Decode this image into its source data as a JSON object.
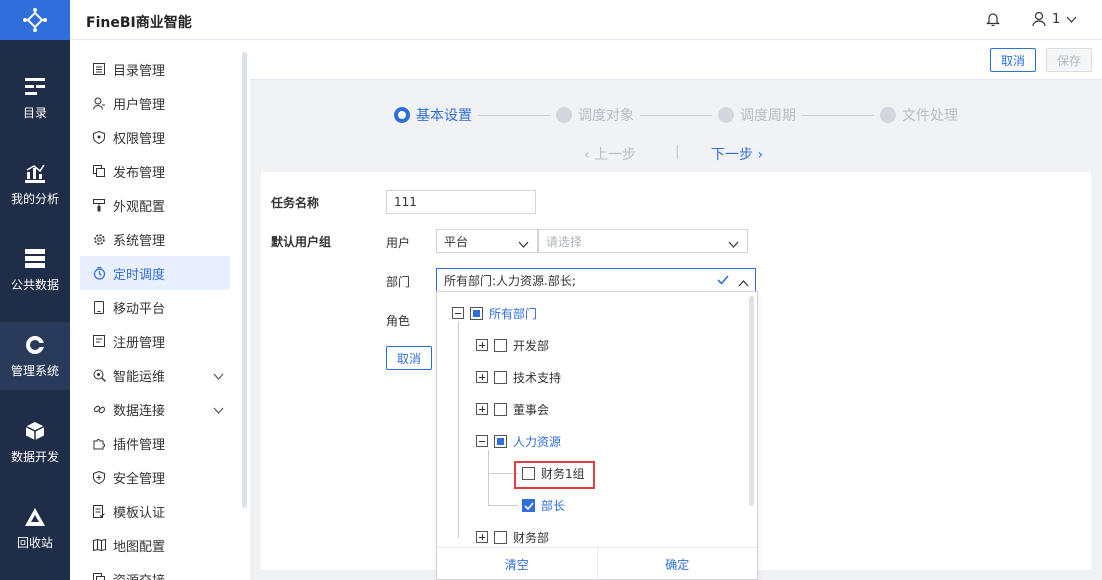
{
  "app": {
    "title": "FineBI商业智能",
    "user": "1"
  },
  "leftnav": [
    {
      "label": "目录",
      "icon": "catalog-icon"
    },
    {
      "label": "我的分析",
      "icon": "analysis-icon"
    },
    {
      "label": "公共数据",
      "icon": "database-icon"
    },
    {
      "label": "管理系统",
      "icon": "gear-icon",
      "active": true
    },
    {
      "label": "数据开发",
      "icon": "cube-icon"
    },
    {
      "label": "回收站",
      "icon": "recycle-icon"
    }
  ],
  "sidebar": {
    "items": [
      {
        "label": "目录管理"
      },
      {
        "label": "用户管理"
      },
      {
        "label": "权限管理"
      },
      {
        "label": "发布管理"
      },
      {
        "label": "外观配置"
      },
      {
        "label": "系统管理"
      },
      {
        "label": "定时调度",
        "active": true
      },
      {
        "label": "移动平台"
      },
      {
        "label": "注册管理"
      },
      {
        "label": "智能运维",
        "expandable": true
      },
      {
        "label": "数据连接",
        "expandable": true
      },
      {
        "label": "插件管理"
      },
      {
        "label": "安全管理"
      },
      {
        "label": "模板认证"
      },
      {
        "label": "地图配置"
      },
      {
        "label": "资源交接"
      }
    ]
  },
  "actions": {
    "cancel": "取消",
    "save": "保存"
  },
  "steps": [
    "基本设置",
    "调度对象",
    "调度周期",
    "文件处理"
  ],
  "nav": {
    "prev": "上一步",
    "next": "下一步",
    "separator": "|"
  },
  "form": {
    "task_name_label": "任务名称",
    "task_name_value": "111",
    "default_group_label": "默认用户组",
    "user_label": "用户",
    "platform_value": "平台",
    "select_placeholder": "请选择",
    "dept_label": "部门",
    "dept_value": "所有部门:人力资源.部长;",
    "role_label": "角色",
    "cancel": "取消"
  },
  "tree": {
    "root": "所有部门",
    "children": [
      "开发部",
      "技术支持",
      "董事会",
      "人力资源",
      "财务部"
    ],
    "hr_children": [
      "财务1组",
      "部长"
    ]
  },
  "tree_footer": {
    "clear": "清空",
    "confirm": "确定"
  },
  "colors": {
    "accent": "#2f6fdc",
    "nav_bg": "#1f2d48",
    "highlight": "#e0413c"
  }
}
